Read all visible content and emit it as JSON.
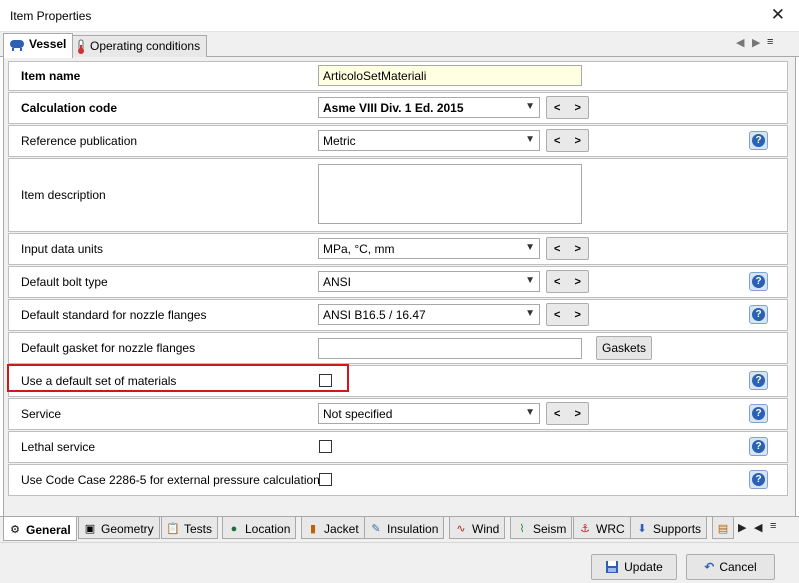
{
  "window": {
    "title": "Item Properties",
    "close": "✕"
  },
  "top_tabs": [
    {
      "label": "Vessel",
      "active": true
    },
    {
      "label": "Operating conditions",
      "active": false
    }
  ],
  "top_tab_nav": {
    "prev": "◀",
    "next": "▶",
    "menu": "≡"
  },
  "fields": {
    "item_name": {
      "label": "Item name",
      "value": "ArticoloSetMateriali"
    },
    "calculation_code": {
      "label": "Calculation code",
      "value": "Asme VIII Div. 1 Ed. 2015"
    },
    "reference_publication": {
      "label": "Reference publication",
      "value": "Metric"
    },
    "item_description": {
      "label": "Item description",
      "value": ""
    },
    "input_data_units": {
      "label": "Input data units",
      "value": "MPa, °C, mm"
    },
    "default_bolt_type": {
      "label": "Default bolt type",
      "value": "ANSI"
    },
    "default_standard_nozzle_flanges": {
      "label": "Default standard for nozzle flanges",
      "value": "ANSI B16.5 / 16.47"
    },
    "default_gasket_nozzle_flanges": {
      "label": "Default gasket for nozzle flanges",
      "value": "",
      "button": "Gaskets"
    },
    "use_default_materials": {
      "label": "Use a default set of materials",
      "checked": false
    },
    "service": {
      "label": "Service",
      "value": "Not specified"
    },
    "lethal_service": {
      "label": "Lethal service",
      "checked": false
    },
    "code_case": {
      "label": "Use Code Case 2286-5 for external pressure calculation",
      "checked": false
    }
  },
  "nav_buttons": {
    "prev": "<",
    "next": ">"
  },
  "help_glyph": "?",
  "bottom_tabs": [
    {
      "label": "General",
      "icon": "gear-icon",
      "active": true
    },
    {
      "label": "Geometry",
      "icon": "cube-icon",
      "active": false
    },
    {
      "label": "Tests",
      "icon": "clipboard-icon",
      "active": false
    },
    {
      "label": "Location",
      "icon": "globe-icon",
      "active": false
    },
    {
      "label": "Jacket",
      "icon": "jacket-icon",
      "active": false
    },
    {
      "label": "Insulation",
      "icon": "pencil-icon",
      "active": false
    },
    {
      "label": "Wind",
      "icon": "wind-icon",
      "active": false
    },
    {
      "label": "Seism",
      "icon": "seism-icon",
      "active": false
    },
    {
      "label": "WRC",
      "icon": "anchor-icon",
      "active": false
    },
    {
      "label": "Supports",
      "icon": "supports-icon",
      "active": false
    }
  ],
  "buttons": {
    "update": "Update",
    "cancel": "Cancel"
  },
  "colors": {
    "highlight": "#d01818",
    "item_name_bg": "#ffffe1",
    "help_blue": "#2a61b3"
  }
}
